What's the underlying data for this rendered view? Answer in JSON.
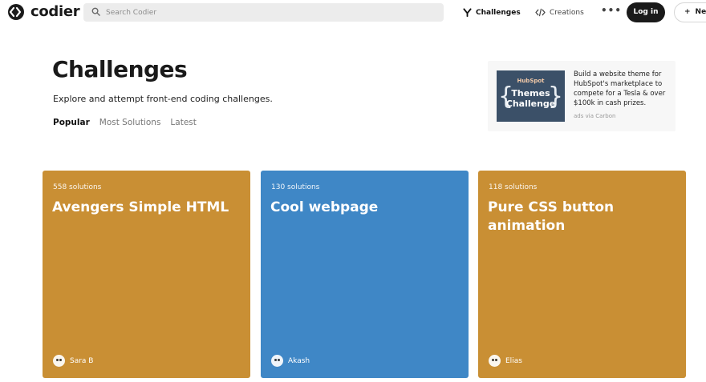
{
  "colors": {
    "card_orange": "#c98f34",
    "card_blue": "#3f87c6",
    "login_bg": "#1a1a1a",
    "search_bg": "#ececec"
  },
  "header": {
    "logo_icon": "codier-logo-icon",
    "brand": "codier",
    "search_placeholder": "Search Codier",
    "nav": {
      "challenges": "Challenges",
      "creations": "Creations",
      "more": "•••"
    },
    "login": "Log in",
    "new_label": "Ne"
  },
  "page": {
    "title": "Challenges",
    "subtitle": "Explore and attempt front-end coding challenges.",
    "tabs": [
      "Popular",
      "Most Solutions",
      "Latest"
    ],
    "active_tab": "Popular"
  },
  "ad": {
    "image_brand": "HubSpot",
    "image_line1": "Themes",
    "image_line2": "Challenge",
    "text": "Build a website theme for HubSpot's marketplace to compete for a Tesla & over $100k in cash prizes.",
    "via": "ads via Carbon"
  },
  "cards": [
    {
      "solutions": "558 solutions",
      "title": "Avengers Simple HTML",
      "author": "Sara B",
      "color": "#c98f34"
    },
    {
      "solutions": "130 solutions",
      "title": "Cool webpage",
      "author": "Akash",
      "color": "#3f87c6"
    },
    {
      "solutions": "118 solutions",
      "title": "Pure CSS button animation",
      "author": "Elias",
      "color": "#c98f34"
    }
  ]
}
